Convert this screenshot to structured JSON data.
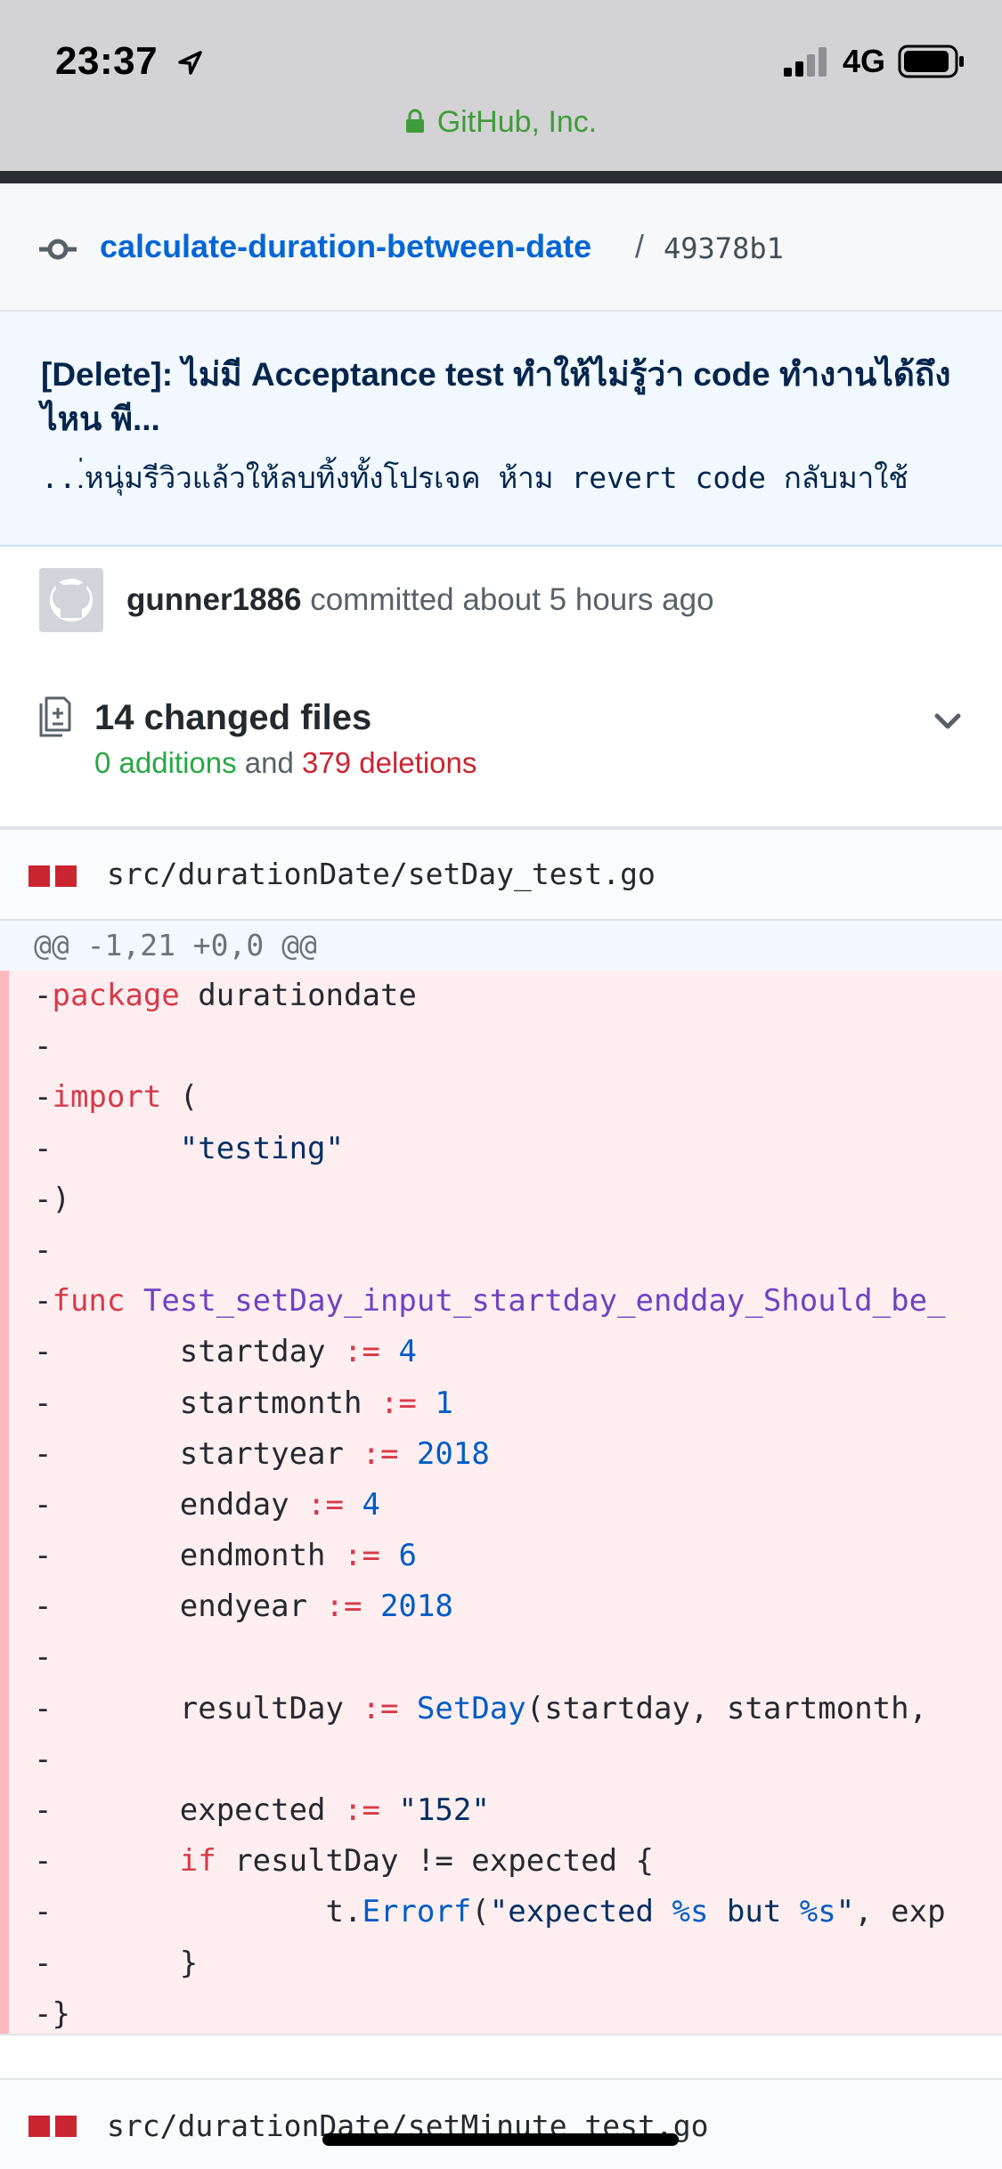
{
  "status": {
    "time": "23:37",
    "network": "4G"
  },
  "url": {
    "site": "GitHub, Inc."
  },
  "breadcrumb": {
    "repo": "calculate-duration-between-date",
    "separator": "/",
    "sha": "49378b1"
  },
  "commit": {
    "title": "[Delete]: ไม่มี Acceptance test ทำให้ไม่รู้ว่า code ทำงานได้ถึงไหน พี...",
    "body": "...่หนุ่มรีวิวแล้วให้ลบทิ้งทั้งโปรเจค ห้าม revert code กลับมาใช้"
  },
  "author": {
    "name": "gunner1886",
    "action": "committed about 5 hours ago"
  },
  "files": {
    "title": "14 changed files",
    "additions": "0 additions",
    "joiner": "and",
    "deletions": "379 deletions"
  },
  "file1": {
    "path": "src/durationDate/setDay_test.go",
    "hunk": "@@ -1,21 +0,0 @@"
  },
  "file2": {
    "path": "src/durationDate/setMinute_test.go"
  },
  "colors": {
    "deletion_bg": "#ffeef0",
    "link": "#0366d6",
    "addition": "#28a745",
    "deletion": "#cb2431"
  }
}
